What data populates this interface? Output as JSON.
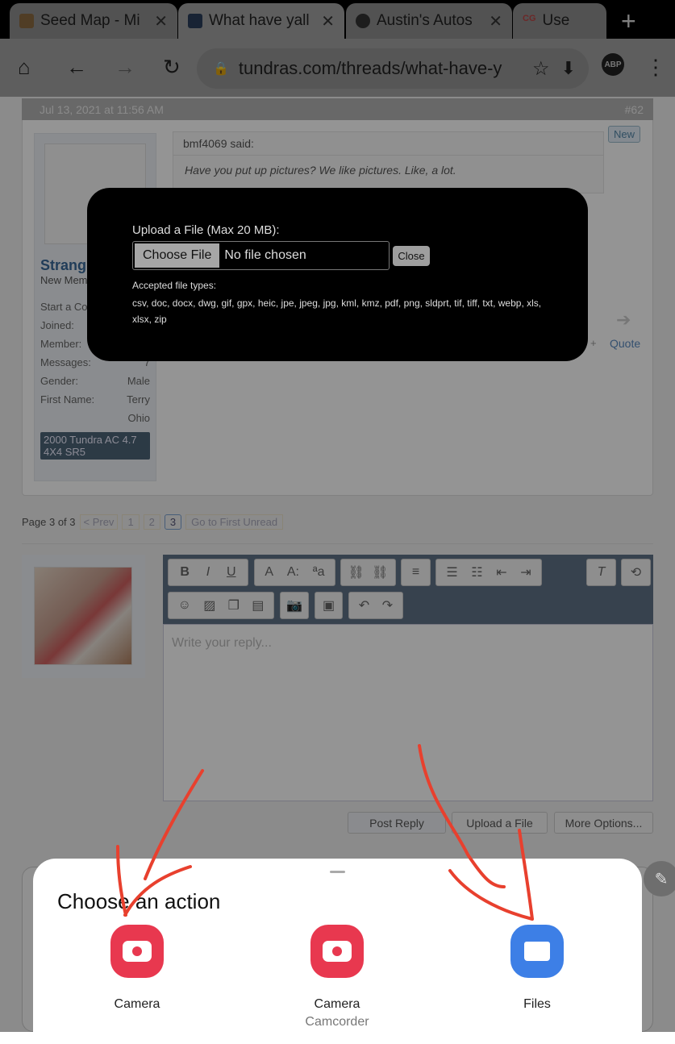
{
  "browser": {
    "tabs": [
      {
        "title": "Seed Map - Mi",
        "active": false
      },
      {
        "title": "What have yall",
        "active": true
      },
      {
        "title": "Austin's Autos",
        "active": false
      },
      {
        "title": "Use",
        "active": false
      }
    ],
    "new_tab": "+",
    "url": "tundras.com/threads/what-have-y",
    "abp": "ABP"
  },
  "post": {
    "date": "Jul 13, 2021 at 11:56 AM",
    "number": "#62",
    "new_badge": "New",
    "quote_author": "bmf4069 said:",
    "quote_text": "Have you put up pictures? We like pictures. Like, a lot.",
    "username": "Strang",
    "user_title": "New Mem",
    "stats": [
      {
        "label": "Start a Co",
        "value": ""
      },
      {
        "label": "Joined:",
        "value": ""
      },
      {
        "label": "Member:",
        "value": ""
      },
      {
        "label": "Messages:",
        "value": "7"
      },
      {
        "label": "Gender:",
        "value": "Male"
      },
      {
        "label": "First Name:",
        "value": "Terry"
      },
      {
        "label": "",
        "value": "Ohio"
      }
    ],
    "vehicle": "2000 Tundra AC 4.7 4X4 SR5",
    "quote_link": "Quote",
    "plus": "+"
  },
  "modal": {
    "label": "Upload a File (Max 20 MB):",
    "choose_file": "Choose File",
    "no_file": "No file chosen",
    "close": "Close",
    "accepted_label": "Accepted file types:",
    "accepted_types": "csv, doc, docx, dwg, gif, gpx, heic, jpe, jpeg, jpg, kml, kmz, pdf, png, sldprt, tif, tiff, txt, webp, xls, xlsx, zip"
  },
  "pagination": {
    "label": "Page 3 of 3",
    "prev": "< Prev",
    "pages": [
      "1",
      "2",
      "3"
    ],
    "current": "3",
    "first_unread": "Go to First Unread"
  },
  "editor": {
    "placeholder": "Write your reply...",
    "post_reply": "Post Reply",
    "upload": "Upload a File",
    "more": "More Options..."
  },
  "sheet": {
    "title": "Choose an action",
    "apps": [
      {
        "label": "Camera",
        "sub": "",
        "color": "#e8384f",
        "icon": "camera-icon"
      },
      {
        "label": "Camera",
        "sub": "Camcorder",
        "color": "#e8384f",
        "icon": "camera-icon"
      },
      {
        "label": "Files",
        "sub": "",
        "color": "#3d7fe6",
        "icon": "folder-icon"
      }
    ]
  },
  "colors": {
    "annotation": "#e8402e",
    "editor_toolbar": "#5f7287"
  }
}
